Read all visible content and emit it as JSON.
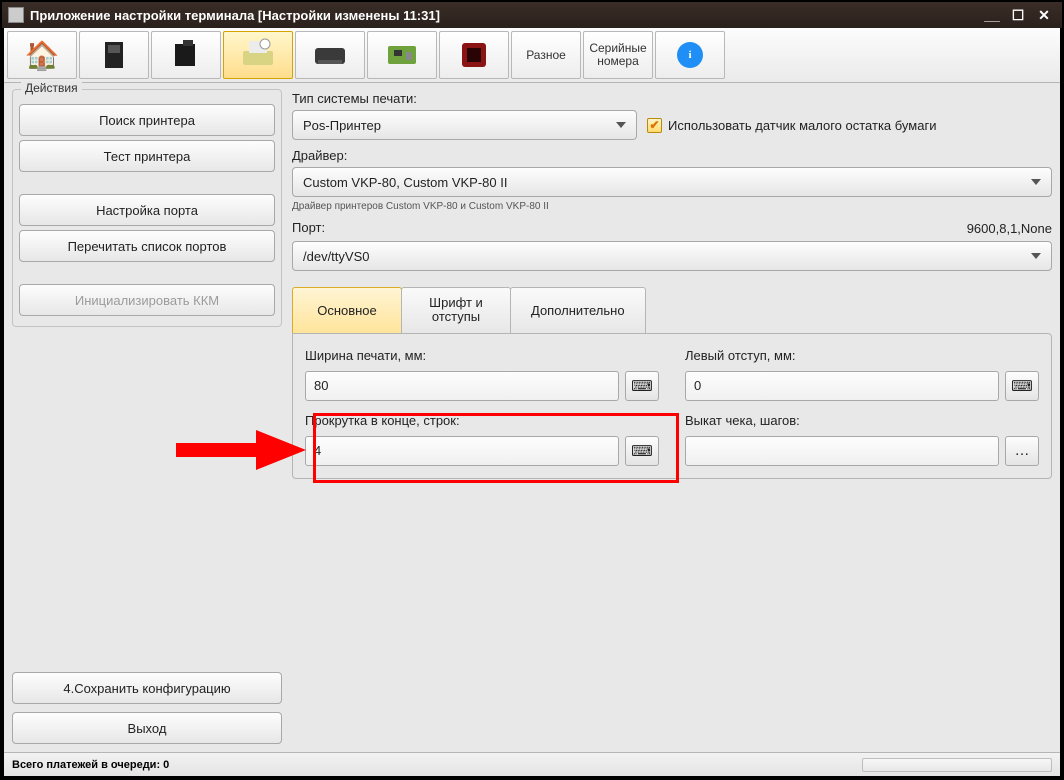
{
  "title": "Приложение настройки терминала [Настройки изменены 11:31]",
  "toolbar": {
    "misc": "Разное",
    "serials": "Серийные\nномера"
  },
  "sidebar": {
    "legend": "Действия",
    "find_printer": "Поиск принтера",
    "test_printer": "Тест принтера",
    "port_setup": "Настройка порта",
    "reread_ports": "Перечитать список портов",
    "init_kkm": "Инициализировать ККМ",
    "save_config": "4.Сохранить конфигурацию",
    "exit": "Выход"
  },
  "content": {
    "print_system_label": "Тип системы печати:",
    "print_system_value": "Pos-Принтер",
    "paper_sensor": "Использовать датчик малого остатка бумаги",
    "driver_label": "Драйвер:",
    "driver_value": "Custom VKP-80, Custom VKP-80 II",
    "driver_note": "Драйвер принтеров Custom VKP-80 и Custom VKP-80 II",
    "port_label": "Порт:",
    "port_params": "9600,8,1,None",
    "port_value": "/dev/ttyVS0",
    "tabs": {
      "main": "Основное",
      "font": "Шрифт и\nотступы",
      "extra": "Дополнительно"
    },
    "fields": {
      "width_label": "Ширина печати, мм:",
      "width_value": "80",
      "left_label": "Левый отступ, мм:",
      "left_value": "0",
      "scroll_label": "Прокрутка в конце, строк:",
      "scroll_value": "4",
      "eject_label": "Выкат чека, шагов:",
      "eject_value": ""
    }
  },
  "status": "Всего платежей в очереди:  0"
}
